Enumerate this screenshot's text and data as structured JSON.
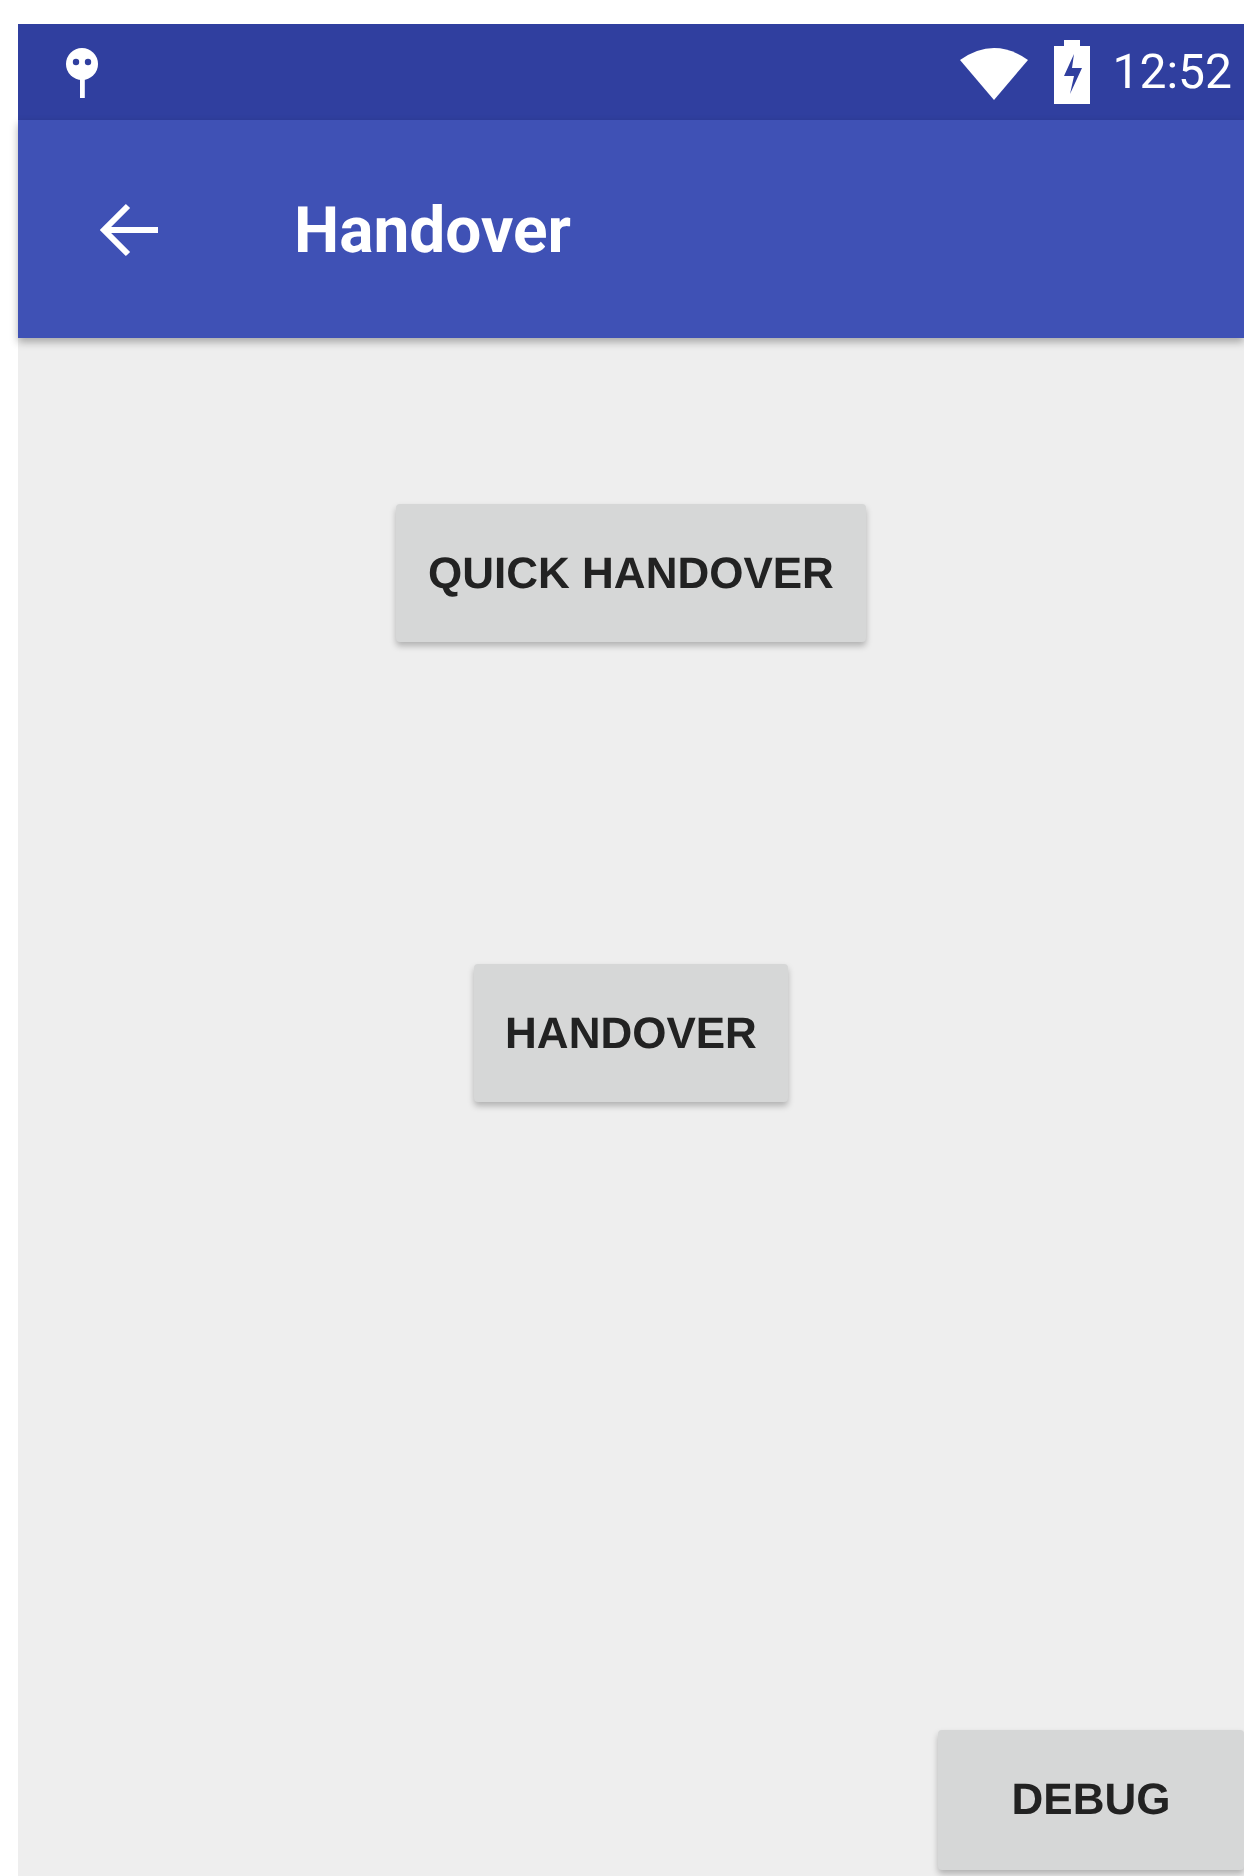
{
  "status_bar": {
    "time": "12:52"
  },
  "app_bar": {
    "title": "Handover"
  },
  "buttons": [
    {
      "label": "QUICK HANDOVER",
      "kind": "center"
    },
    {
      "label": "HANDOVER",
      "kind": "center"
    },
    {
      "label": "DEBUG",
      "kind": "corner"
    }
  ]
}
